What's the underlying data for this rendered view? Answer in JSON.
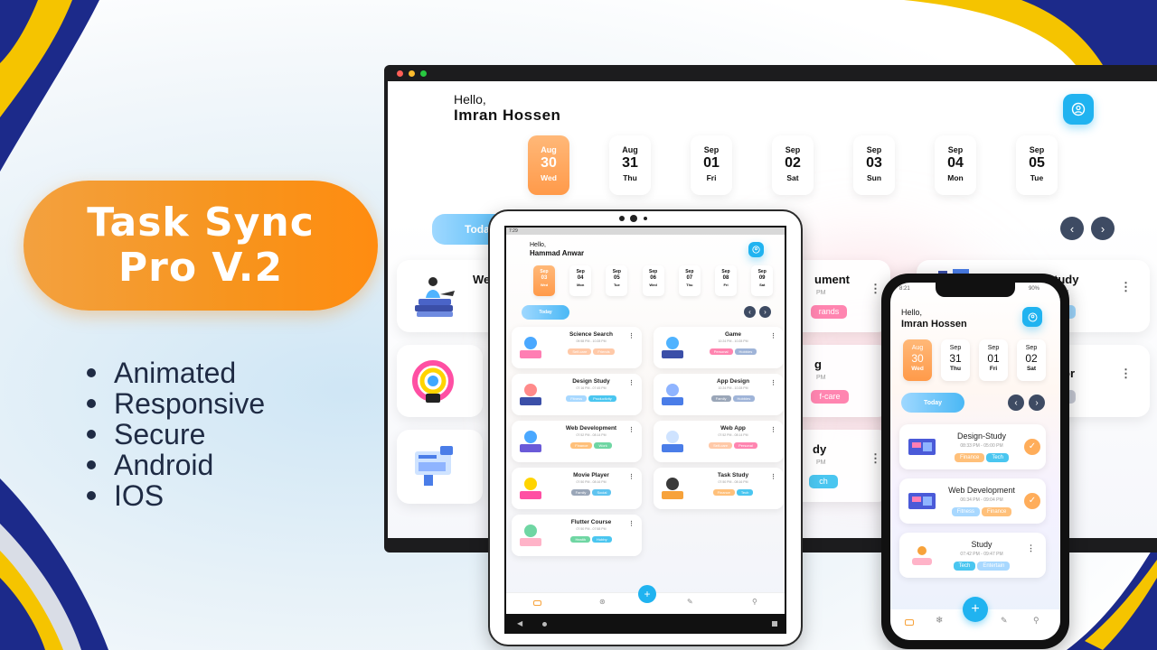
{
  "colors": {
    "accent": "#20b3f0",
    "orange": "#f7941d",
    "navy": "#1c2a8a",
    "yellow": "#f5c400",
    "nav_dark": "#3e4b63"
  },
  "promo": {
    "title_line1": "Task Sync",
    "title_line2": "Pro V.2",
    "features": [
      "Animated",
      "Responsive",
      "Secure",
      "Android",
      "IOS"
    ]
  },
  "desktop": {
    "greeting": "Hello,",
    "user": "Imran Hossen",
    "dates": [
      {
        "month": "Aug",
        "day": "30",
        "weekday": "Wed",
        "active": true
      },
      {
        "month": "Aug",
        "day": "31",
        "weekday": "Thu"
      },
      {
        "month": "Sep",
        "day": "01",
        "weekday": "Fri"
      },
      {
        "month": "Sep",
        "day": "02",
        "weekday": "Sat"
      },
      {
        "month": "Sep",
        "day": "03",
        "weekday": "Sun"
      },
      {
        "month": "Sep",
        "day": "04",
        "weekday": "Mon"
      },
      {
        "month": "Sep",
        "day": "05",
        "weekday": "Tue"
      }
    ],
    "today_label": "Today",
    "partial_cards": [
      {
        "title_fragment": "We"
      },
      {
        "title_fragment": "ument",
        "time_fragment": "PM",
        "tag": "rands"
      },
      {
        "title_fragment": "tudy",
        "time_fragment": "PM"
      },
      {
        "title_fragment": "g",
        "time_fragment": "PM",
        "tag": "f-care"
      },
      {
        "title_fragment": "or"
      },
      {
        "title_fragment": "dy",
        "time_fragment": "PM",
        "tag": "ch"
      }
    ]
  },
  "tablet": {
    "greeting": "Hello,",
    "user": "Hammad Anwar",
    "status_time": "7:29",
    "dates": [
      {
        "month": "Sep",
        "day": "03",
        "weekday": "Wed",
        "active": true
      },
      {
        "month": "Sep",
        "day": "04",
        "weekday": "Mon"
      },
      {
        "month": "Sep",
        "day": "05",
        "weekday": "Tue"
      },
      {
        "month": "Sep",
        "day": "06",
        "weekday": "Wed"
      },
      {
        "month": "Sep",
        "day": "07",
        "weekday": "Thu"
      },
      {
        "month": "Sep",
        "day": "08",
        "weekday": "Fri"
      },
      {
        "month": "Sep",
        "day": "09",
        "weekday": "Sat"
      }
    ],
    "today_label": "Today",
    "tasks": [
      {
        "title": "Science Search",
        "time": "09:58 PM - 10:28 PM",
        "tags": [
          "Self-care",
          "Friends"
        ]
      },
      {
        "title": "Game",
        "time": "10:24 PM - 10:28 PM",
        "tags": [
          "Personal",
          "Hobbies"
        ]
      },
      {
        "title": "Design Study",
        "time": "07:16 PM - 07:45 PM",
        "tags": [
          "Fitness",
          "Productivity"
        ]
      },
      {
        "title": "App Design",
        "time": "10:24 PM - 10:28 PM",
        "tags": [
          "Family",
          "Hobbies"
        ]
      },
      {
        "title": "Web Development",
        "time": "07:52 PM - 08:14 PM",
        "tags": [
          "Finance",
          "Work"
        ]
      },
      {
        "title": "Web App",
        "time": "07:52 PM - 08:14 PM",
        "tags": [
          "Self-care",
          "Personal"
        ]
      },
      {
        "title": "Movie Player",
        "time": "07:50 PM - 08:16 PM",
        "tags": [
          "Family",
          "Social"
        ]
      },
      {
        "title": "Task Study",
        "time": "07:50 PM - 08:16 PM",
        "tags": [
          "Finance",
          "Tech"
        ]
      },
      {
        "title": "Flutter Course",
        "time": "07:50 PM - 07:58 PM",
        "tags": [
          "Health",
          "Hobby"
        ]
      }
    ]
  },
  "phone": {
    "greeting": "Hello,",
    "user": "Imran Hossen",
    "status_time": "8:21",
    "battery": "90%",
    "dates": [
      {
        "month": "Aug",
        "day": "30",
        "weekday": "Wed",
        "active": true
      },
      {
        "month": "Sep",
        "day": "31",
        "weekday": "Thu"
      },
      {
        "month": "Sep",
        "day": "01",
        "weekday": "Fri"
      },
      {
        "month": "Sep",
        "day": "02",
        "weekday": "Sat"
      }
    ],
    "today_label": "Today",
    "tasks": [
      {
        "title": "Design-Study",
        "time": "08:33 PM - 05:00 PM",
        "tags": [
          "Finance",
          "Tech"
        ],
        "done": true
      },
      {
        "title": "Web Development",
        "time": "06:34 PM - 09:04 PM",
        "tags": [
          "Fitness",
          "Finance"
        ],
        "done": true
      },
      {
        "title": "Study",
        "time": "07:42 PM - 09:47 PM",
        "tags": [
          "Tech",
          "Entertain"
        ],
        "done": false
      }
    ]
  }
}
